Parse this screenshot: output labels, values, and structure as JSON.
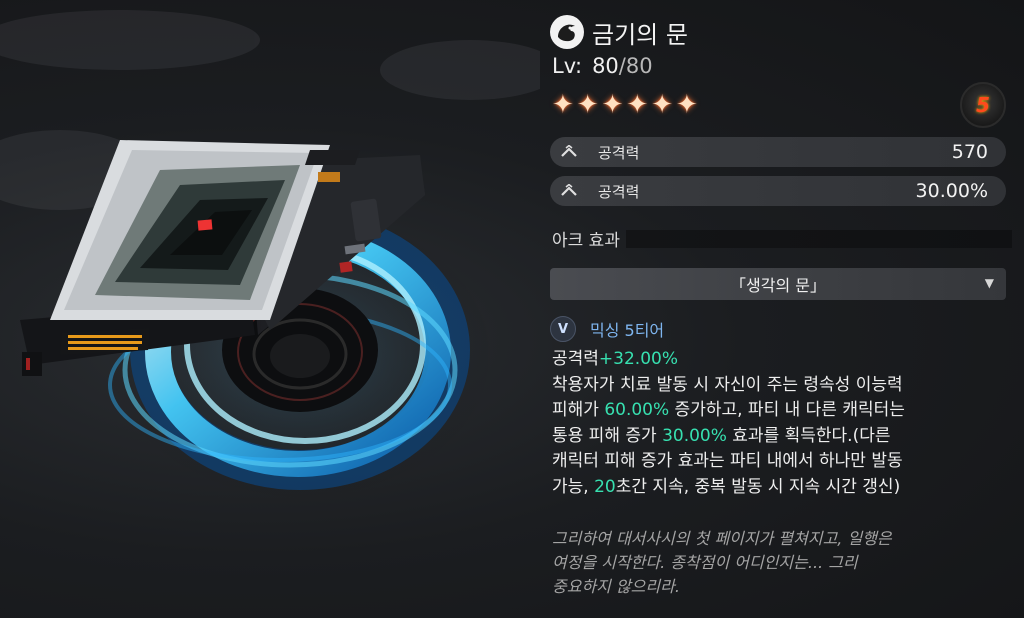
{
  "item": {
    "name": "금기의 문",
    "level_label": "Lv:",
    "level_current": "80",
    "level_max": "/80",
    "stars": 6,
    "star_glyph": "✦",
    "badge_text": "5"
  },
  "stats": [
    {
      "icon": "chevron-up-icon",
      "label": "공격력",
      "value": "570"
    },
    {
      "icon": "chevron-up-icon",
      "label": "공격력",
      "value": "30.00%"
    }
  ],
  "ark": {
    "section_label": "아크 효과",
    "effect_name": "「생각의 문」",
    "tier_icon_letter": "V",
    "tier_label": "믹싱 5티어",
    "bonus_prefix": "공격력",
    "bonus_value": "+32.00%",
    "line1": "착용자가 치료 발동 시 자신이 주는 령속성 이능력",
    "line2_a": "피해가 ",
    "line2_v": "60.00%",
    "line2_b": " 증가하고, 파티 내 다른 캐릭터는",
    "line3_a": "통용 피해 증가 ",
    "line3_v": "30.00%",
    "line3_b": " 효과를 획득한다.(다른",
    "line4": "캐릭터 피해 증가 효과는 파티 내에서 하나만 발동",
    "line5_a": "가능, ",
    "line5_v": "20",
    "line5_b": "초간 지속, 중복 발동 시 지속 시간 갱신)"
  },
  "flavor": {
    "line1": "그리하여 대서사시의 첫 페이지가 펼쳐지고, 일행은",
    "line2": "여정을 시작한다. 종착점이 어디인지는... 그리",
    "line3": "중요하지 않으리라."
  },
  "colors": {
    "highlight": "#37e0b0",
    "tier": "#7fb6f0",
    "star": "#ffe1c2",
    "badge": "#ff4a1c",
    "portal": "#38c8ff"
  }
}
